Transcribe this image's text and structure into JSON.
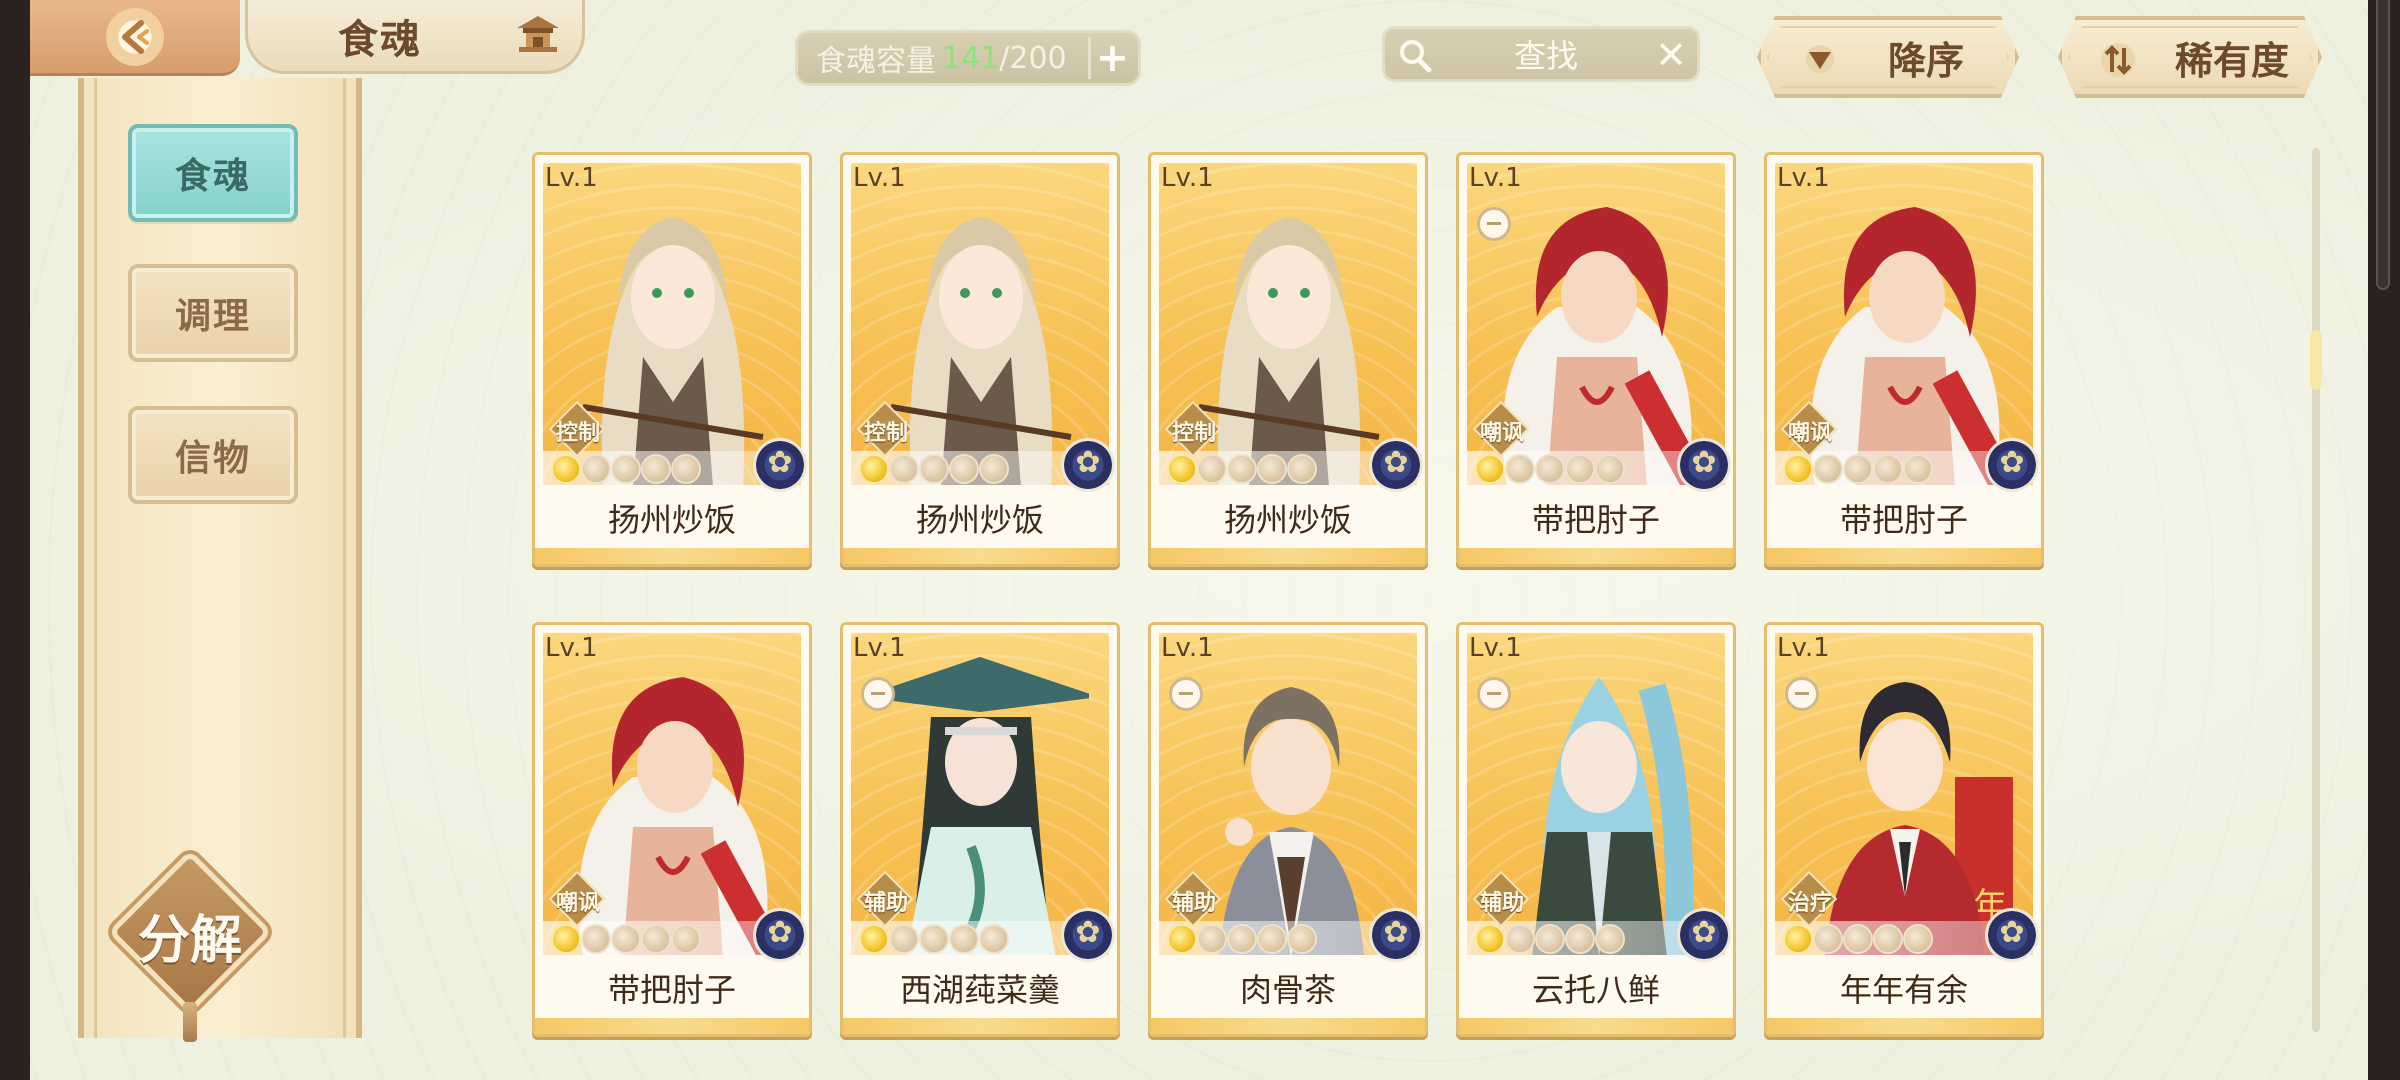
{
  "header": {
    "title": "食魂"
  },
  "capacity": {
    "label": "食魂容量",
    "current": "141",
    "total": "/200",
    "add_symbol": "+"
  },
  "search": {
    "placeholder": "查找",
    "clear_symbol": "✕"
  },
  "sort": {
    "order_label": "降序",
    "rarity_label": "稀有度"
  },
  "sidebar": {
    "items": [
      {
        "label": "食魂",
        "active": true
      },
      {
        "label": "调理",
        "active": false
      },
      {
        "label": "信物",
        "active": false
      }
    ],
    "decompose_label": "分解"
  },
  "colors": {
    "accent_teal": "#86d1cb",
    "card_gold": "#f7c052",
    "capacity_green": "#8fe07a"
  },
  "cards": [
    {
      "level": "Lv.1",
      "name": "扬州炒饭",
      "role": "控制",
      "stars_filled": 1,
      "stars_total": 5,
      "char": "blond",
      "favorite_mark": false
    },
    {
      "level": "Lv.1",
      "name": "扬州炒饭",
      "role": "控制",
      "stars_filled": 1,
      "stars_total": 5,
      "char": "blond",
      "favorite_mark": false
    },
    {
      "level": "Lv.1",
      "name": "扬州炒饭",
      "role": "控制",
      "stars_filled": 1,
      "stars_total": 5,
      "char": "blond",
      "favorite_mark": false
    },
    {
      "level": "Lv.1",
      "name": "带把肘子",
      "role": "嘲讽",
      "stars_filled": 1,
      "stars_total": 5,
      "char": "redhair",
      "favorite_mark": true
    },
    {
      "level": "Lv.1",
      "name": "带把肘子",
      "role": "嘲讽",
      "stars_filled": 1,
      "stars_total": 5,
      "char": "redhair",
      "favorite_mark": false
    },
    {
      "level": "Lv.1",
      "name": "带把肘子",
      "role": "嘲讽",
      "stars_filled": 1,
      "stars_total": 5,
      "char": "redhair",
      "favorite_mark": false
    },
    {
      "level": "Lv.1",
      "name": "西湖莼菜羹",
      "role": "辅助",
      "stars_filled": 1,
      "stars_total": 5,
      "char": "hat",
      "favorite_mark": true
    },
    {
      "level": "Lv.1",
      "name": "肉骨茶",
      "role": "辅助",
      "stars_filled": 1,
      "stars_total": 5,
      "char": "brown",
      "favorite_mark": true
    },
    {
      "level": "Lv.1",
      "name": "云托八鲜",
      "role": "辅助",
      "stars_filled": 1,
      "stars_total": 5,
      "char": "bluehair",
      "favorite_mark": true
    },
    {
      "level": "Lv.1",
      "name": "年年有余",
      "role": "治疗",
      "stars_filled": 1,
      "stars_total": 5,
      "char": "darkhair",
      "favorite_mark": true
    }
  ]
}
